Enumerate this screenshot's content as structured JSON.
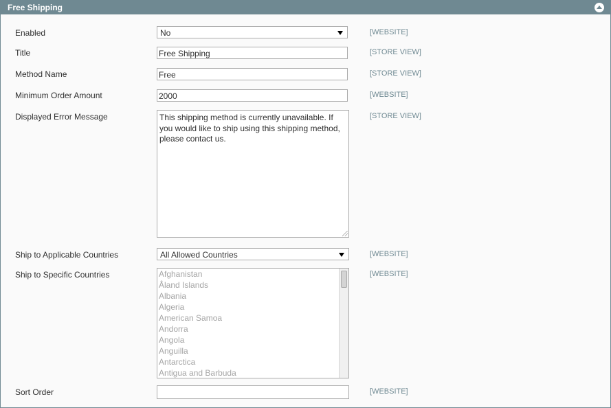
{
  "section": {
    "title": "Free Shipping",
    "collapse_icon": "chevron-up-icon"
  },
  "fields": {
    "enabled": {
      "label": "Enabled",
      "value": "No",
      "scope": "[WEBSITE]"
    },
    "title": {
      "label": "Title",
      "value": "Free Shipping",
      "scope": "[STORE VIEW]"
    },
    "method_name": {
      "label": "Method Name",
      "value": "Free",
      "scope": "[STORE VIEW]"
    },
    "min_order": {
      "label": "Minimum Order Amount",
      "value": "2000",
      "scope": "[WEBSITE]"
    },
    "error_message": {
      "label": "Displayed Error Message",
      "value": "This shipping method is currently unavailable. If you would like to ship using this shipping method, please contact us.",
      "scope": "[STORE VIEW]"
    },
    "applicable_countries": {
      "label": "Ship to Applicable Countries",
      "value": "All Allowed Countries",
      "scope": "[WEBSITE]"
    },
    "specific_countries": {
      "label": "Ship to Specific Countries",
      "scope": "[WEBSITE]",
      "options": [
        "Afghanistan",
        "Åland Islands",
        "Albania",
        "Algeria",
        "American Samoa",
        "Andorra",
        "Angola",
        "Anguilla",
        "Antarctica",
        "Antigua and Barbuda"
      ]
    },
    "sort_order": {
      "label": "Sort Order",
      "value": "",
      "scope": "[WEBSITE]"
    }
  },
  "colors": {
    "header_bg": "#6f8992",
    "scope_text": "#6f8992",
    "disabled_option": "#a5a5a5"
  }
}
